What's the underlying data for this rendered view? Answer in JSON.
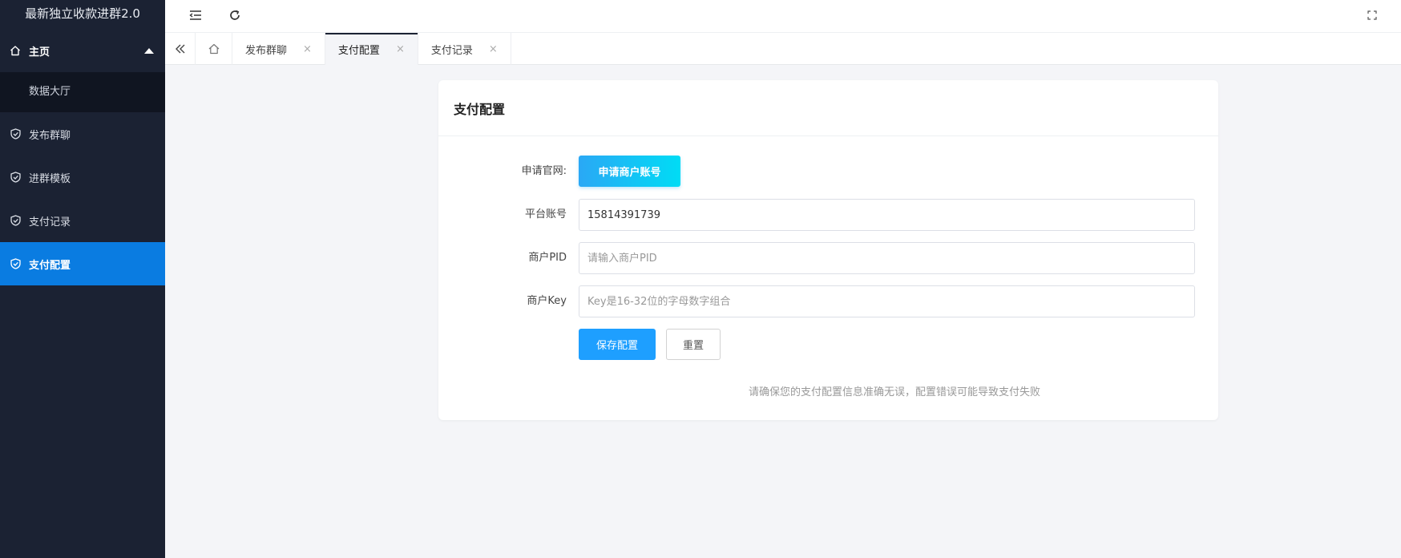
{
  "app": {
    "title": "最新独立收款进群2.0"
  },
  "sidebar": {
    "home": {
      "label": "主页",
      "icon": "home-icon"
    },
    "home_sub": [
      {
        "label": "数据大厅"
      }
    ],
    "items": [
      {
        "label": "发布群聊",
        "icon": "shield-check-icon"
      },
      {
        "label": "进群模板",
        "icon": "shield-check-icon"
      },
      {
        "label": "支付记录",
        "icon": "shield-check-icon"
      },
      {
        "label": "支付配置",
        "icon": "shield-check-icon",
        "active": true
      }
    ]
  },
  "topbar": {
    "icons": [
      "menu-fold-icon",
      "refresh-icon",
      "fullscreen-icon"
    ]
  },
  "tabs": [
    {
      "label": "发布群聊",
      "close": "×"
    },
    {
      "label": "支付配置",
      "close": "×",
      "active": true
    },
    {
      "label": "支付记录",
      "close": "×"
    }
  ],
  "form": {
    "title": "支付配置",
    "apply": {
      "label": "申请官网:",
      "button": "申请商户账号"
    },
    "account": {
      "label": "平台账号",
      "value": "15814391739"
    },
    "pid": {
      "label": "商户PID",
      "placeholder": "请输入商户PID"
    },
    "key": {
      "label": "商户Key",
      "placeholder": "Key是16-32位的字母数字组合"
    },
    "save": "保存配置",
    "reset": "重置",
    "hint": "请确保您的支付配置信息准确无误，配置错误可能导致支付失败"
  },
  "colors": {
    "sidebar_bg": "#1b2233",
    "active": "#0a7ce1",
    "primary": "#1e9fff"
  }
}
